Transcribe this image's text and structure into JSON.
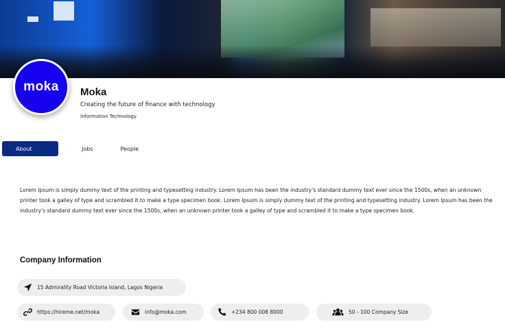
{
  "company": {
    "logo_text": "moka",
    "name": "Moka",
    "tagline": "Creating the future of finance with technology",
    "industry": "Information Technology",
    "brand_color": "#1500f0"
  },
  "tabs": [
    {
      "label": "About",
      "active": true
    },
    {
      "label": "Jobs",
      "active": false
    },
    {
      "label": "People",
      "active": false
    }
  ],
  "about": {
    "text": "Lorem Ipsum is simply dummy text of the printing and typesetting industry. Lorem Ipsum has been the industry's standard dummy text ever since the 1500s, when an unknown printer took a galley of type and scrambled it to make a type specimen book. Lorem Ipsum is simply dummy text of the printing and typesetting industry. Lorem Ipsum has been the industry's standard dummy text ever since the 1500s, when an unknown printer took a galley of type and scrambled it to make a type specimen book."
  },
  "company_info": {
    "title": "Company Information",
    "address": {
      "icon": "location-arrow-icon",
      "text": "15 Admirality Road Victoria Island, Lagos Nigeria"
    },
    "website": {
      "icon": "link-icon",
      "text": "https://hireme.net/moka"
    },
    "email": {
      "icon": "envelope-icon",
      "text": "info@moka.com"
    },
    "phone": {
      "icon": "phone-icon",
      "text": "+234 800 008 8000"
    },
    "size": {
      "icon": "users-icon",
      "text": "50 - 100 Company Size"
    }
  },
  "colors": {
    "active_tab": "#0b2a82",
    "pill_background": "#eeeeee"
  }
}
